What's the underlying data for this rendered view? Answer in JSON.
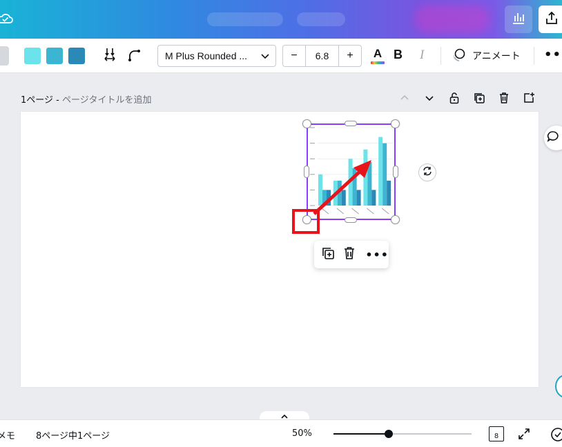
{
  "toolbar": {
    "swatches": [
      "#6ae4ea",
      "#3bb5d1",
      "#2b89b8"
    ],
    "font_name": "M Plus Rounded ...",
    "font_size": "6.8",
    "minus": "−",
    "plus": "+",
    "text_color_label": "A",
    "bold_label": "B",
    "italic_label": "I",
    "animate_label": "アニメート",
    "more_label": "•••"
  },
  "page": {
    "number_label": "1ページ - ",
    "title_placeholder": "ページタイトルを追加"
  },
  "chart_data": {
    "type": "bar",
    "categories": [
      "",
      "",
      "",
      "",
      ""
    ],
    "series": [
      {
        "color": "#6ae4ea",
        "values": [
          20,
          16,
          30,
          36,
          44
        ]
      },
      {
        "color": "#3bb5d1",
        "values": [
          10,
          16,
          24,
          28,
          40
        ]
      },
      {
        "color": "#2b89b8",
        "values": [
          10,
          10,
          10,
          10,
          16
        ]
      }
    ],
    "ylim": [
      0,
      50
    ],
    "grid": true
  },
  "context_menu": {
    "more_label": "•••"
  },
  "bottom": {
    "memo": "メモ",
    "page_indicator": "8ページ中1ページ",
    "zoom": "50%",
    "zoom_fraction": 0.4,
    "page_count": "8"
  },
  "colors": {
    "selection": "#8b3dff",
    "annotation": "#e8141b"
  }
}
